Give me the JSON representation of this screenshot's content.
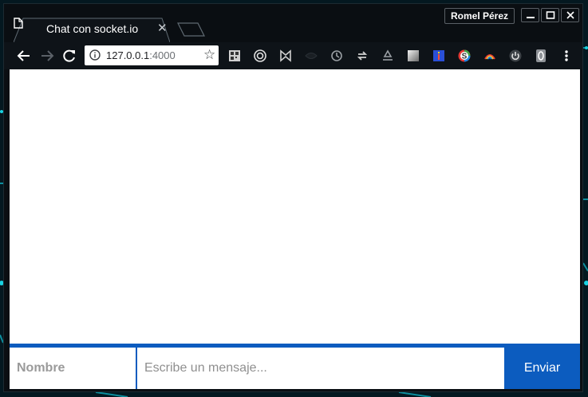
{
  "browser": {
    "tab_title": "Chat con socket.io",
    "profile_name": "Romel Pérez",
    "url_host": "127.0.0.1",
    "url_port": ":4000",
    "extensions": [
      "qr-code-icon",
      "target-icon",
      "bowtie-icon",
      "eye-icon",
      "history-icon",
      "sync-icon",
      "recycle-icon",
      "gradient-square-icon",
      "info-blue-icon",
      "s-colored-icon",
      "rainbow-icon",
      "power-icon",
      "zero-icon"
    ]
  },
  "chat": {
    "name_placeholder": "Nombre",
    "message_placeholder": "Escribe un mensaje...",
    "send_label": "Enviar"
  },
  "colors": {
    "accent": "#0c5cbf",
    "chrome_dark": "#0a0e12",
    "desktop_teal": "#14c8d8"
  }
}
